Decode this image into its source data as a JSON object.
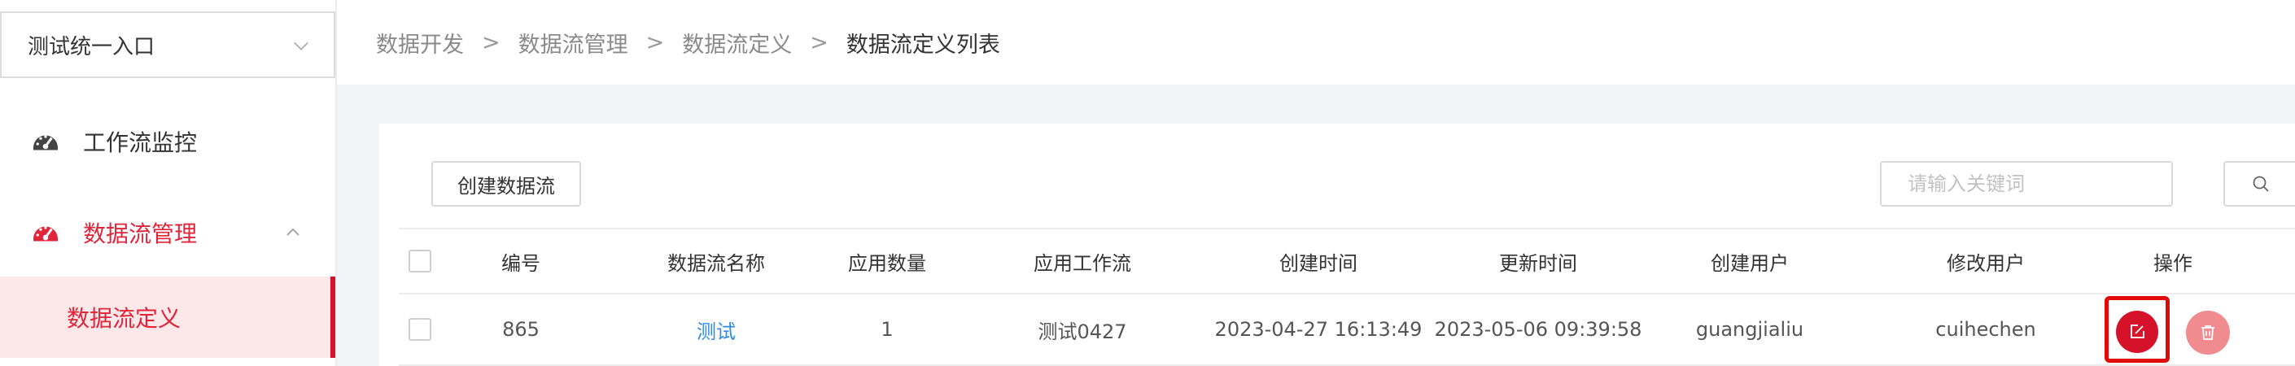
{
  "sidebar": {
    "entry_select": {
      "value": "测试统一入口"
    },
    "menu": [
      {
        "label": "工作流监控",
        "icon": "dashboard-icon"
      },
      {
        "label": "数据流管理",
        "icon": "dashboard-icon",
        "expanded": true
      }
    ],
    "submenu": [
      {
        "label": "数据流定义",
        "active": true
      }
    ]
  },
  "breadcrumb": [
    "数据开发",
    "数据流管理",
    "数据流定义",
    "数据流定义列表"
  ],
  "breadcrumb_separator": ">",
  "toolbar": {
    "create_label": "创建数据流",
    "search_placeholder": "请输入关键词"
  },
  "table": {
    "columns": [
      "编号",
      "数据流名称",
      "应用数量",
      "应用工作流",
      "创建时间",
      "更新时间",
      "创建用户",
      "修改用户",
      "操作"
    ],
    "rows": [
      {
        "id": "865",
        "name": "测试",
        "app_count": "1",
        "workflow": "测试0427",
        "created_at": "2023-04-27 16:13:49",
        "updated_at": "2023-05-06 09:39:58",
        "created_by": "guangjialiu",
        "modified_by": "cuihechen"
      }
    ]
  },
  "colors": {
    "accent": "#e0243a",
    "active_bg": "#fde8e9",
    "link": "#2f8be5",
    "edit_button": "#d6122a",
    "delete_button": "#f08c8f"
  }
}
